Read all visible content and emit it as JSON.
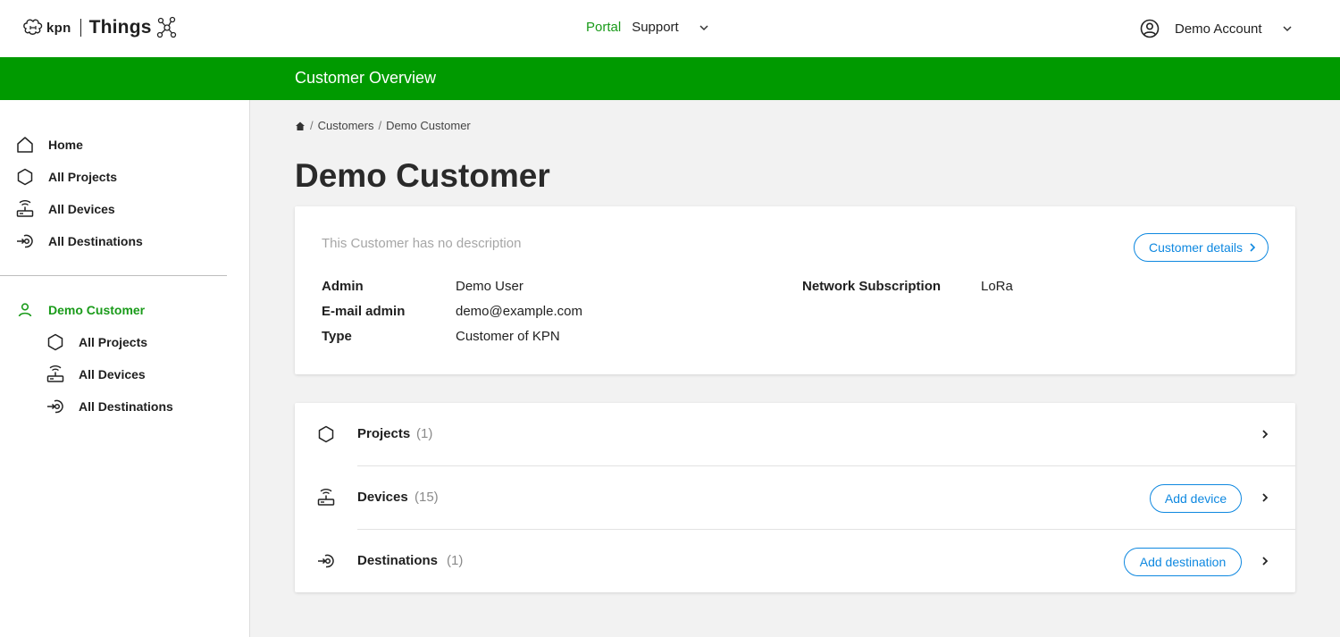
{
  "header": {
    "brand": "kpn",
    "product": "Things",
    "nav": {
      "portal": "Portal",
      "support": "Support"
    },
    "account": "Demo Account"
  },
  "band": {
    "title": "Customer Overview"
  },
  "sidebar": {
    "items": [
      {
        "label": "Home",
        "icon": "home-icon"
      },
      {
        "label": "All Projects",
        "icon": "hexagon-icon"
      },
      {
        "label": "All Devices",
        "icon": "device-icon"
      },
      {
        "label": "All Destinations",
        "icon": "destination-icon"
      }
    ],
    "customer": {
      "label": "Demo Customer",
      "icon": "user-icon",
      "items": [
        {
          "label": "All Projects",
          "icon": "hexagon-icon"
        },
        {
          "label": "All Devices",
          "icon": "device-icon"
        },
        {
          "label": "All Destinations",
          "icon": "destination-icon"
        }
      ]
    }
  },
  "breadcrumb": {
    "items": [
      "Customers",
      "Demo Customer"
    ]
  },
  "page": {
    "title": "Demo Customer"
  },
  "details": {
    "no_description": "This Customer has no description",
    "details_button": "Customer details",
    "fields": [
      {
        "key": "Admin",
        "value": "Demo User"
      },
      {
        "key": "E-mail admin",
        "value": "demo@example.com"
      },
      {
        "key": "Type",
        "value": "Customer of KPN"
      },
      {
        "key": "Network Subscription",
        "value": "LoRa"
      }
    ]
  },
  "resources": [
    {
      "label": "Projects",
      "count": "(1)"
    },
    {
      "label": "Devices",
      "count": "(15)",
      "action": "Add device"
    },
    {
      "label": "Destinations",
      "count": "(1)",
      "action": "Add destination"
    }
  ],
  "colors": {
    "brand_green": "#009a00",
    "link_green": "#1a9b1a",
    "accent_blue": "#0e88e0"
  }
}
